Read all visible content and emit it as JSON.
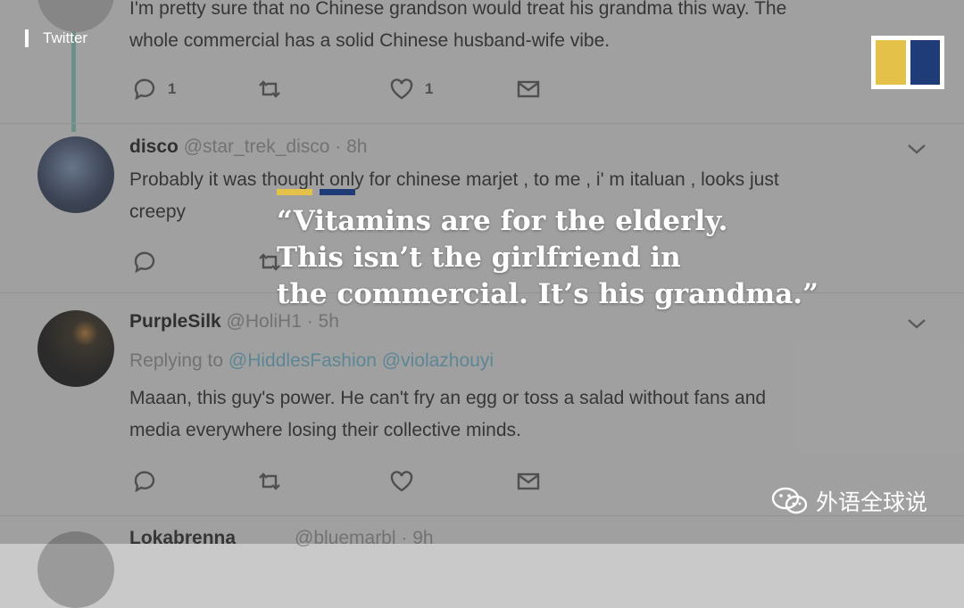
{
  "overlay_label": "Twitter",
  "caption": {
    "line1": "“Vitamins are for the elderly.",
    "line2": "This isn’t the girlfriend in",
    "line3": "the commercial. It’s his grandma.”"
  },
  "watermark": "外语全球说",
  "tweets": [
    {
      "text_line1": "I'm pretty sure that no Chinese grandson would treat his grandma this way. The",
      "text_line2": "whole commercial has a solid Chinese husband-wife vibe.",
      "reply_count": "1",
      "like_count": "1"
    },
    {
      "name": "disco",
      "handle": "@star_trek_disco",
      "time": "· 8h",
      "text_line1": "Probably it was thought only for chinese marjet , to me , i' m italuan , looks just",
      "text_line2": "creepy"
    },
    {
      "name": "PurpleSilk",
      "handle": "@HoliH1",
      "time": "· 5h",
      "replying_prefix": "Replying to",
      "replying_to": "@HiddlesFashion @violazhouyi",
      "text_line1": "Maaan, this guy's power. He can't fry an egg or toss a salad without fans and",
      "text_line2": "media everywhere losing their collective minds."
    },
    {
      "name": "Lokabrenna",
      "handle_partial": "@bluemarbl · 9h"
    }
  ],
  "colors": {
    "logo_yellow": "#e4c24a",
    "logo_blue": "#1f3b78",
    "thread_line": "#7fb8ad",
    "link": "#6aa9bf"
  }
}
